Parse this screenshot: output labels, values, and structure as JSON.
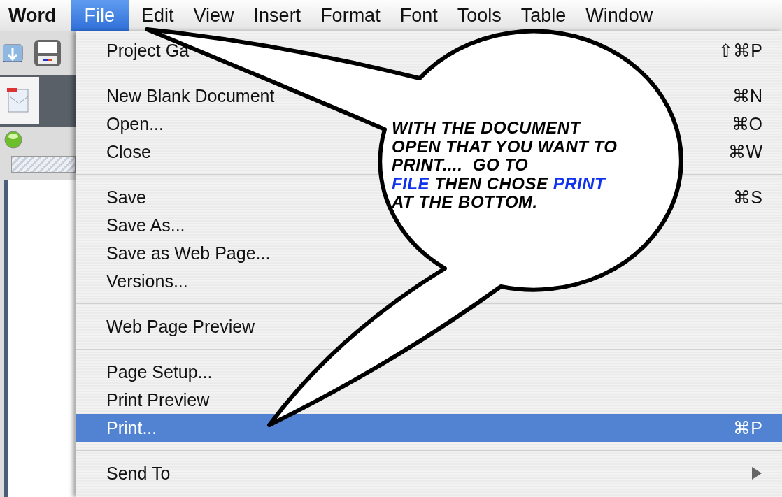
{
  "menu_bar": {
    "app_name": "Word",
    "items": [
      {
        "label": "File",
        "selected": true
      },
      {
        "label": "Edit",
        "selected": false
      },
      {
        "label": "View",
        "selected": false
      },
      {
        "label": "Insert",
        "selected": false
      },
      {
        "label": "Format",
        "selected": false
      },
      {
        "label": "Font",
        "selected": false
      },
      {
        "label": "Tools",
        "selected": false
      },
      {
        "label": "Table",
        "selected": false
      },
      {
        "label": "Window",
        "selected": false
      }
    ]
  },
  "file_menu": {
    "items": [
      {
        "kind": "item",
        "label": "Project Ga",
        "shortcut": "⇧⌘P",
        "selected": false
      },
      {
        "kind": "separator"
      },
      {
        "kind": "item",
        "label": "New Blank Document",
        "shortcut": "⌘N",
        "selected": false
      },
      {
        "kind": "item",
        "label": "Open...",
        "shortcut": "⌘O",
        "selected": false
      },
      {
        "kind": "item",
        "label": "Close",
        "shortcut": "⌘W",
        "selected": false
      },
      {
        "kind": "separator"
      },
      {
        "kind": "item",
        "label": "Save",
        "shortcut": "⌘S",
        "selected": false
      },
      {
        "kind": "item",
        "label": "Save As...",
        "selected": false
      },
      {
        "kind": "item",
        "label": "Save as Web Page...",
        "selected": false
      },
      {
        "kind": "item",
        "label": "Versions...",
        "selected": false
      },
      {
        "kind": "separator"
      },
      {
        "kind": "item",
        "label": "Web Page Preview",
        "selected": false
      },
      {
        "kind": "separator"
      },
      {
        "kind": "item",
        "label": "Page Setup...",
        "selected": false
      },
      {
        "kind": "item",
        "label": "Print Preview",
        "selected": false
      },
      {
        "kind": "item",
        "label": "Print...",
        "shortcut": "⌘P",
        "selected": true
      },
      {
        "kind": "separator"
      },
      {
        "kind": "item",
        "label": "Send To",
        "selected": false,
        "submenu": true
      }
    ]
  },
  "callout": {
    "lines": [
      [
        {
          "text": "WITH THE DOCUMENT",
          "emphasized": false
        }
      ],
      [
        {
          "text": "OPEN THAT YOU WANT TO",
          "emphasized": false
        }
      ],
      [
        {
          "text": "PRINT....  GO TO",
          "emphasized": false
        }
      ],
      [
        {
          "text": "FILE",
          "emphasized": true
        },
        {
          "text": " THEN CHOSE ",
          "emphasized": false
        },
        {
          "text": "PRINT",
          "emphasized": true
        }
      ],
      [
        {
          "text": "AT THE BOTTOM.",
          "emphasized": false
        }
      ]
    ]
  }
}
